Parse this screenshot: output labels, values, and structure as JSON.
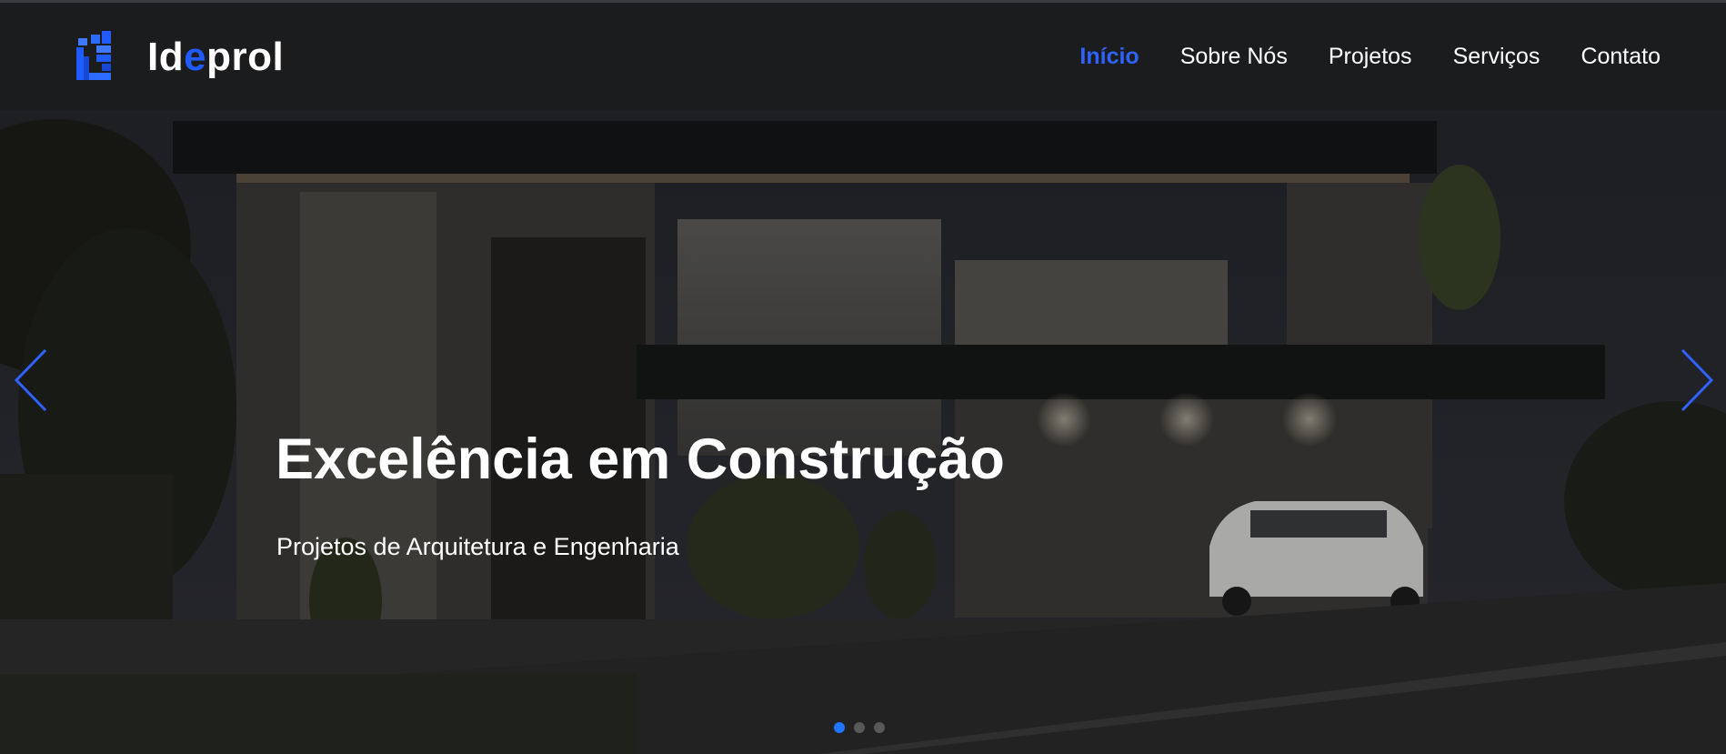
{
  "header": {
    "logo": {
      "text_before": "Id",
      "text_accent": "e",
      "text_after": "prol",
      "icon": "building-blocks-icon"
    },
    "nav": [
      {
        "label": "Início",
        "active": true
      },
      {
        "label": "Sobre Nós",
        "active": false
      },
      {
        "label": "Projetos",
        "active": false
      },
      {
        "label": "Serviços",
        "active": false
      },
      {
        "label": "Contato",
        "active": false
      }
    ]
  },
  "hero": {
    "title": "Excelência em Construção",
    "subtitle": "Projetos de Arquitetura e Engenharia",
    "prev_icon": "chevron-left-icon",
    "next_icon": "chevron-right-icon",
    "slides_indicator": {
      "count": 3,
      "active_index": 1
    }
  },
  "colors": {
    "accent": "#1f5bff",
    "nav_background": "#1b1c1e",
    "text": "#ffffff",
    "dot_active": "#1f75ff"
  }
}
